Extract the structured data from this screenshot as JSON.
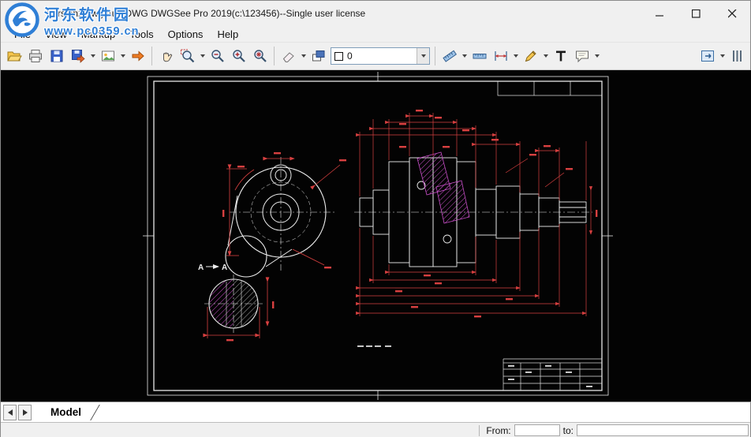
{
  "window": {
    "title": "Version2.dwg AutoDWG DWGSee Pro 2019(c:\\123456)--Single user license"
  },
  "menu": {
    "items": [
      {
        "label": "File"
      },
      {
        "label": "View"
      },
      {
        "label": "Markup"
      },
      {
        "label": "Tools"
      },
      {
        "label": "Options"
      },
      {
        "label": "Help"
      }
    ]
  },
  "toolbar": {
    "layer_value": "0"
  },
  "watermark": {
    "site_name": "河东软件园",
    "site_url": "www.pc0359.cn"
  },
  "drawing": {
    "section_label_a1": "A",
    "section_label_a2": "A"
  },
  "tabbar": {
    "model_tab": "Model"
  },
  "statusbar": {
    "from_label": "From:",
    "to_label": "to:"
  }
}
